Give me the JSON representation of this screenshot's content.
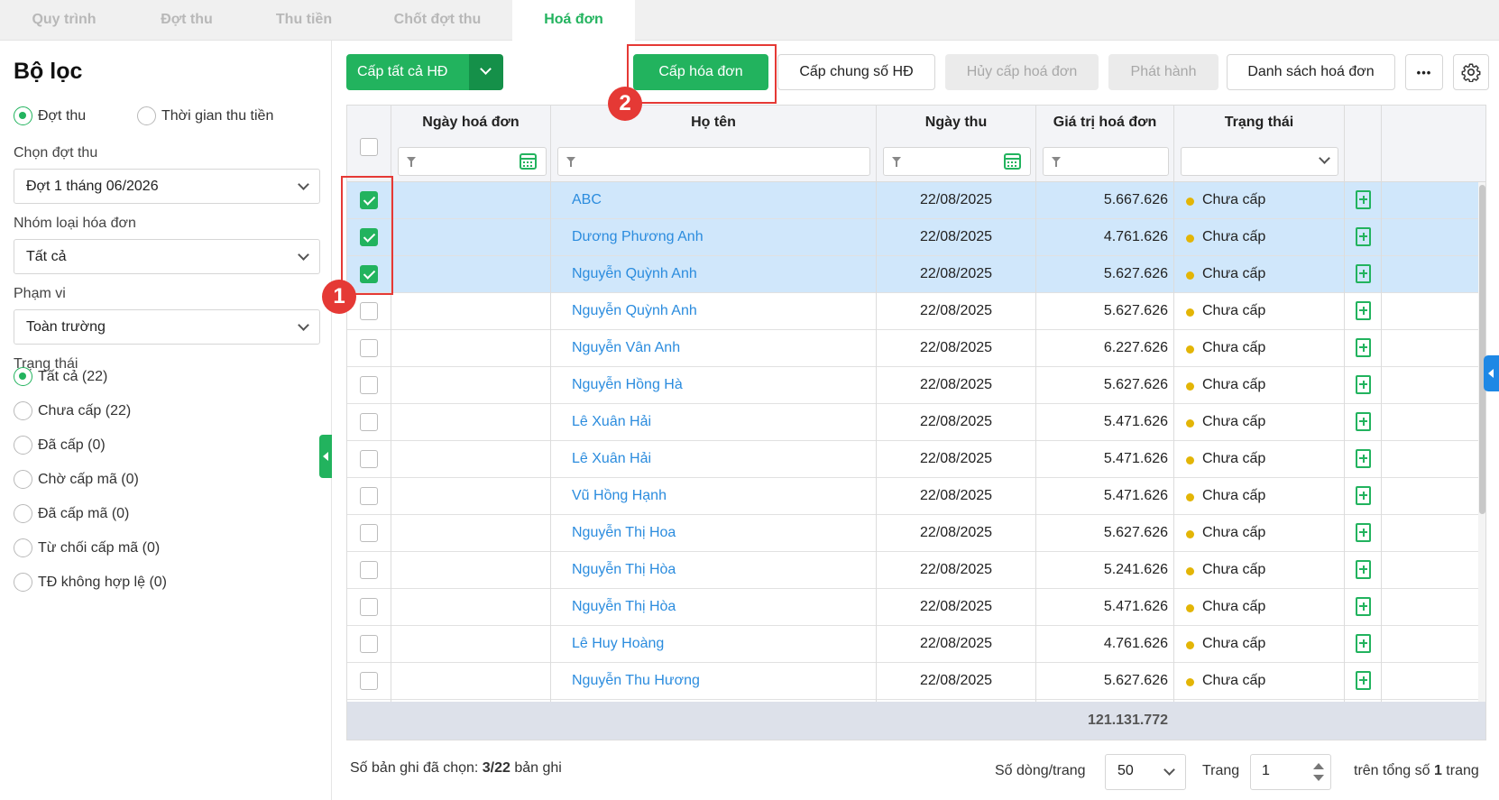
{
  "tabs": [
    {
      "label": "Quy trình",
      "active": false
    },
    {
      "label": "Đợt thu",
      "active": false
    },
    {
      "label": "Thu tiền",
      "active": false
    },
    {
      "label": "Chốt đợt thu",
      "active": false
    },
    {
      "label": "Hoá đơn",
      "active": true
    }
  ],
  "sidebar": {
    "title": "Bộ lọc",
    "mode_options": [
      "Đợt thu",
      "Thời gian thu tiền"
    ],
    "mode_selected": "Đợt thu",
    "period_label": "Chọn đợt thu",
    "period_value": "Đợt 1 tháng 06/2026",
    "invoice_group_label": "Nhóm loại hóa đơn",
    "invoice_group_value": "Tất cả",
    "scope_label": "Phạm vi",
    "scope_value": "Toàn trường",
    "status_label": "Trạng thái",
    "status_options": [
      "Tất cả (22)",
      "Chưa cấp (22)",
      "Đã cấp (0)",
      "Chờ cấp mã (0)",
      "Đã cấp mã (0)",
      "Từ chối cấp mã (0)",
      "TĐ không hợp lệ (0)"
    ],
    "status_selected": "Tất cả (22)"
  },
  "toolbar": {
    "issue_all_label": "Cấp tất cả HĐ",
    "issue_label": "Cấp hóa đơn",
    "issue_common_label": "Cấp chung số HĐ",
    "cancel_issue_label": "Hủy cấp hoá đơn",
    "publish_label": "Phát hành",
    "invoice_list_label": "Danh sách hoá đơn",
    "more_label": "•••"
  },
  "annotations": {
    "step1": "1",
    "step2": "2"
  },
  "grid": {
    "columns": {
      "invoice_date": "Ngày hoá đơn",
      "full_name": "Họ tên",
      "collect_date": "Ngày thu",
      "invoice_value": "Giá trị hoá đơn",
      "status": "Trạng thái"
    },
    "rows": [
      {
        "invoice_date": "",
        "name": "ABC",
        "collect_date": "22/08/2025",
        "value": "5.667.626",
        "status": "Chưa cấp",
        "checked": true
      },
      {
        "invoice_date": "",
        "name": "Dương Phương Anh",
        "collect_date": "22/08/2025",
        "value": "4.761.626",
        "status": "Chưa cấp",
        "checked": true
      },
      {
        "invoice_date": "",
        "name": "Nguyễn Quỳnh Anh",
        "collect_date": "22/08/2025",
        "value": "5.627.626",
        "status": "Chưa cấp",
        "checked": true
      },
      {
        "invoice_date": "",
        "name": "Nguyễn Quỳnh Anh",
        "collect_date": "22/08/2025",
        "value": "5.627.626",
        "status": "Chưa cấp",
        "checked": false
      },
      {
        "invoice_date": "",
        "name": "Nguyễn Vân Anh",
        "collect_date": "22/08/2025",
        "value": "6.227.626",
        "status": "Chưa cấp",
        "checked": false
      },
      {
        "invoice_date": "",
        "name": "Nguyễn Hồng Hà",
        "collect_date": "22/08/2025",
        "value": "5.627.626",
        "status": "Chưa cấp",
        "checked": false
      },
      {
        "invoice_date": "",
        "name": "Lê Xuân Hải",
        "collect_date": "22/08/2025",
        "value": "5.471.626",
        "status": "Chưa cấp",
        "checked": false
      },
      {
        "invoice_date": "",
        "name": "Lê Xuân Hải",
        "collect_date": "22/08/2025",
        "value": "5.471.626",
        "status": "Chưa cấp",
        "checked": false
      },
      {
        "invoice_date": "",
        "name": "Vũ Hồng Hạnh",
        "collect_date": "22/08/2025",
        "value": "5.471.626",
        "status": "Chưa cấp",
        "checked": false
      },
      {
        "invoice_date": "",
        "name": "Nguyễn Thị Hoa",
        "collect_date": "22/08/2025",
        "value": "5.627.626",
        "status": "Chưa cấp",
        "checked": false
      },
      {
        "invoice_date": "",
        "name": "Nguyễn Thị Hòa",
        "collect_date": "22/08/2025",
        "value": "5.241.626",
        "status": "Chưa cấp",
        "checked": false
      },
      {
        "invoice_date": "",
        "name": "Nguyễn Thị Hòa",
        "collect_date": "22/08/2025",
        "value": "5.471.626",
        "status": "Chưa cấp",
        "checked": false
      },
      {
        "invoice_date": "",
        "name": "Lê Huy Hoàng",
        "collect_date": "22/08/2025",
        "value": "4.761.626",
        "status": "Chưa cấp",
        "checked": false
      },
      {
        "invoice_date": "",
        "name": "Nguyễn Thu Hương",
        "collect_date": "22/08/2025",
        "value": "5.627.626",
        "status": "Chưa cấp",
        "checked": false
      }
    ],
    "total": "121.131.772"
  },
  "footer": {
    "selected_prefix": "Số bản ghi đã chọn: ",
    "selected_count": "3/22",
    "selected_suffix": " bản ghi",
    "rows_per_page_label": "Số dòng/trang",
    "rows_per_page_value": "50",
    "page_label": "Trang",
    "page_value": "1",
    "total_pages_prefix": "trên tổng số ",
    "total_pages": "1",
    "total_pages_suffix": " trang"
  },
  "colors": {
    "accent": "#22b35e",
    "link": "#2b8cde",
    "selected_row": "#d0e7fb",
    "annotation": "#e53935",
    "status_pending": "#e3b506"
  }
}
